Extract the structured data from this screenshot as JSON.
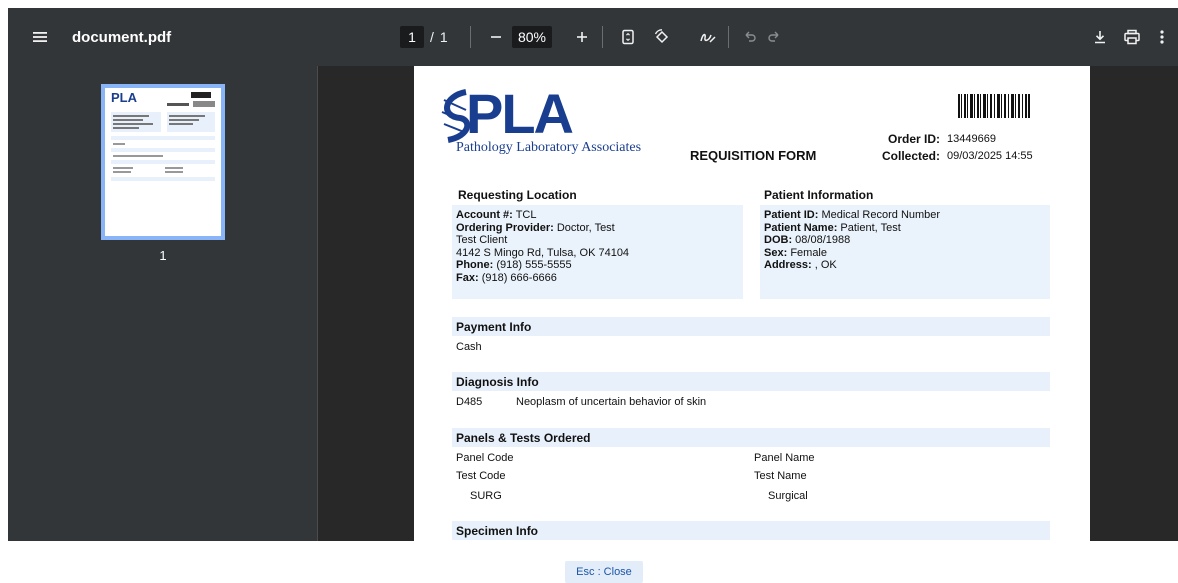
{
  "toolbar": {
    "menu_icon": "hamburger-menu-icon",
    "title": "document.pdf",
    "page_current": "1",
    "page_separator": "/",
    "page_total": "1",
    "zoom_out_icon": "minus-icon",
    "zoom_value": "80%",
    "zoom_in_icon": "plus-icon",
    "fit_icon": "fit-page-icon",
    "rotate_icon": "rotate-icon",
    "annotate_icon": "pen-icon",
    "undo_icon": "undo-icon",
    "redo_icon": "redo-icon",
    "download_icon": "download-icon",
    "print_icon": "print-icon",
    "more_icon": "more-vert-icon"
  },
  "sidebar": {
    "thumbnail_label": "1"
  },
  "document": {
    "logo": "PLA",
    "logo_sub": "Pathology Laboratory Associates",
    "form_title": "REQUISITION FORM",
    "order_id_label": "Order ID:",
    "order_id_value": "13449669",
    "collected_label": "Collected:",
    "collected_value": "09/03/2025 14:55",
    "requesting_location": {
      "heading": "Requesting Location",
      "account_label": "Account #:",
      "account_value": "TCL",
      "provider_label": "Ordering Provider:",
      "provider_value": "Doctor, Test",
      "client": "Test Client",
      "address": "4142 S Mingo Rd, Tulsa, OK 74104",
      "phone_label": "Phone:",
      "phone_value": "(918) 555-5555",
      "fax_label": "Fax:",
      "fax_value": "(918) 666-6666"
    },
    "patient_information": {
      "heading": "Patient Information",
      "patient_id_label": "Patient ID:",
      "patient_id_value": "Medical Record Number",
      "patient_name_label": "Patient Name:",
      "patient_name_value": "Patient, Test",
      "dob_label": "DOB:",
      "dob_value": "08/08/1988",
      "sex_label": "Sex:",
      "sex_value": "Female",
      "address_label": "Address:",
      "address_value": ", OK"
    },
    "payment": {
      "heading": "Payment Info",
      "value": "Cash"
    },
    "diagnosis": {
      "heading": "Diagnosis Info",
      "code": "D485",
      "description": "Neoplasm of uncertain behavior of skin"
    },
    "panels": {
      "heading": "Panels & Tests Ordered",
      "panel_code_label": "Panel Code",
      "panel_name_label": "Panel Name",
      "test_code_label": "Test Code",
      "test_name_label": "Test Name",
      "test_code": "SURG",
      "test_name": "Surgical"
    },
    "specimen": {
      "heading": "Specimen Info"
    }
  },
  "footer": {
    "esc_close": "Esc : Close"
  }
}
